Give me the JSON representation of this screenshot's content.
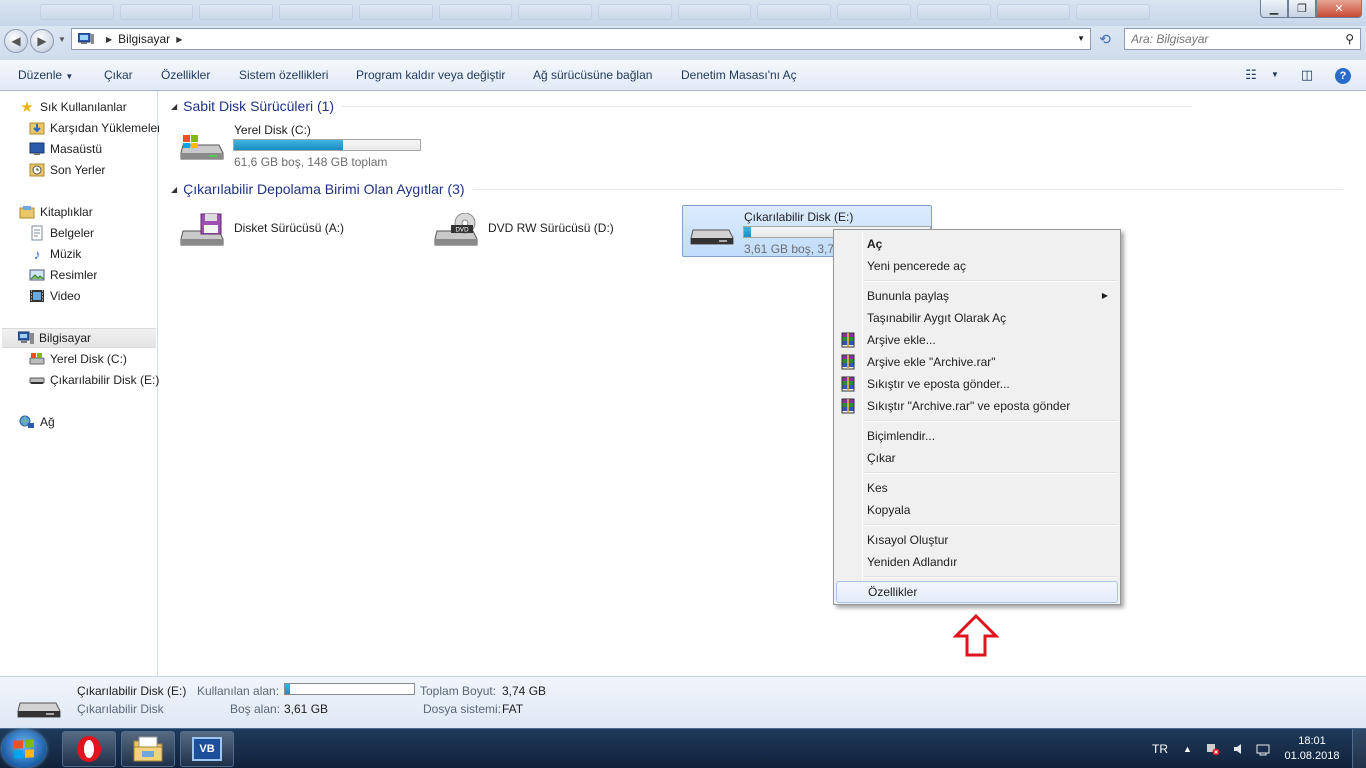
{
  "address": {
    "location": "Bilgisayar"
  },
  "search": {
    "placeholder": "Ara: Bilgisayar"
  },
  "toolbar": {
    "organize": "Düzenle",
    "eject": "Çıkar",
    "properties": "Özellikler",
    "system_properties": "Sistem özellikleri",
    "uninstall": "Program kaldır veya değiştir",
    "map_drive": "Ağ sürücüsüne bağlan",
    "control_panel": "Denetim Masası'nı Aç"
  },
  "sidebar": {
    "favorites": "Sık Kullanılanlar",
    "downloads": "Karşıdan Yüklemeler",
    "desktop": "Masaüstü",
    "recent": "Son Yerler",
    "libraries": "Kitaplıklar",
    "documents": "Belgeler",
    "music": "Müzik",
    "pictures": "Resimler",
    "video": "Video",
    "computer": "Bilgisayar",
    "local_disk": "Yerel Disk (C:)",
    "removable": "Çıkarılabilir Disk (E:)",
    "network": "Ağ"
  },
  "groups": {
    "hdd": "Sabit Disk Sürücüleri (1)",
    "removable": "Çıkarılabilir Depolama Birimi Olan Aygıtlar (3)"
  },
  "drives": {
    "c": {
      "name": "Yerel Disk (C:)",
      "info": "61,6 GB boş, 148 GB toplam",
      "used_fraction": 0.584
    },
    "a": {
      "name": "Disket Sürücüsü (A:)"
    },
    "d": {
      "name": "DVD RW Sürücüsü (D:)"
    },
    "e": {
      "name": "Çıkarılabilir Disk (E:)",
      "info": "3,61 GB boş, 3,74 GB toplam",
      "used_fraction": 0.035
    }
  },
  "menu": {
    "open": "Aç",
    "open_new_window": "Yeni pencerede aç",
    "share_with": "Bununla paylaş",
    "open_as_portable": "Taşınabilir Aygıt Olarak Aç",
    "add_archive": "Arşive ekle...",
    "add_archive_rar": "Arşive ekle \"Archive.rar\"",
    "compress_email": "Sıkıştır ve eposta gönder...",
    "compress_rar_email": "Sıkıştır \"Archive.rar\" ve eposta gönder",
    "format": "Biçimlendir...",
    "eject": "Çıkar",
    "cut": "Kes",
    "copy": "Kopyala",
    "create_shortcut": "Kısayol Oluştur",
    "rename": "Yeniden Adlandır",
    "properties": "Özellikler"
  },
  "details": {
    "name": "Çıkarılabilir Disk (E:)",
    "type": "Çıkarılabilir Disk",
    "used_label": "Kullanılan alan:",
    "used_fraction": 0.035,
    "free_label": "Boş alan:",
    "free_value": "3,61 GB",
    "total_label": "Toplam Boyut:",
    "total_value": "3,74 GB",
    "fs_label": "Dosya sistemi:",
    "fs_value": "FAT"
  },
  "taskbar": {
    "language": "TR",
    "time": "18:01",
    "date": "01.08.2018",
    "vb_label": "VB"
  },
  "colors": {
    "accent": "#1a8dc4",
    "group_heading": "#1e3287",
    "annotation_arrow": "#e0141e"
  }
}
